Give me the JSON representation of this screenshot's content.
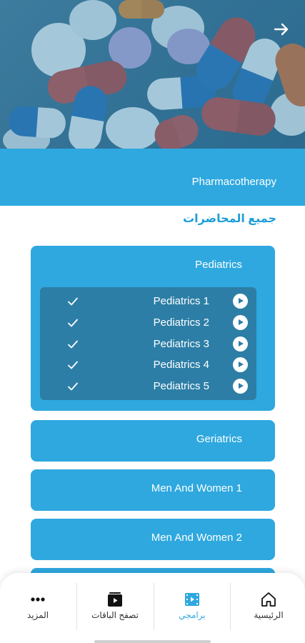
{
  "header": {
    "back_icon": "arrow-right-icon",
    "course_title": "Pharmacotherapy"
  },
  "section": {
    "heading": "جميع المحاضرات"
  },
  "modules": [
    {
      "title": "Pediatrics",
      "expanded": true,
      "lessons": [
        {
          "label": "Pediatrics 1",
          "completed": true
        },
        {
          "label": "Pediatrics 2",
          "completed": true
        },
        {
          "label": "Pediatrics 3",
          "completed": true
        },
        {
          "label": "Pediatrics 4",
          "completed": true
        },
        {
          "label": "Pediatrics 5",
          "completed": true
        }
      ]
    },
    {
      "title": "Geriatrics",
      "expanded": false
    },
    {
      "title": "Men And Women 1",
      "expanded": false
    },
    {
      "title": "Men And Women 2",
      "expanded": false
    }
  ],
  "bottom_nav": {
    "items": [
      {
        "label": "المزيد",
        "icon": "more-dots-icon",
        "active": false
      },
      {
        "label": "تصفح الباقات",
        "icon": "packages-play-icon",
        "active": false
      },
      {
        "label": "برامجي",
        "icon": "my-programs-film-icon",
        "active": true
      },
      {
        "label": "الرئيسية",
        "icon": "home-icon",
        "active": false
      }
    ]
  },
  "colors": {
    "primary": "#2ea8df",
    "lesson_panel": "#2c7ea6",
    "heading_text": "#1f9ed8"
  }
}
